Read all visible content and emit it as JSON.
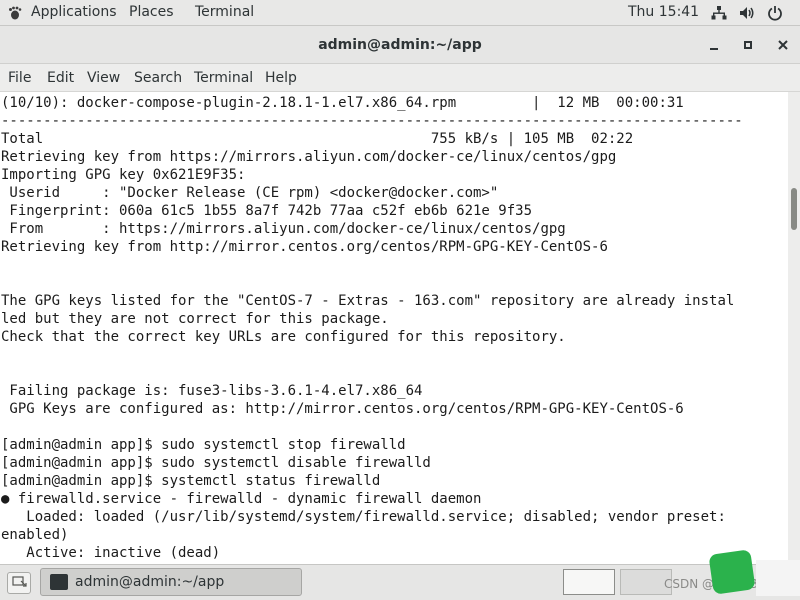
{
  "topbar": {
    "applications": "Applications",
    "places": "Places",
    "terminal": "Terminal",
    "clock": "Thu 15:41",
    "icons": [
      "network-icon",
      "volume-icon",
      "power-icon"
    ]
  },
  "window": {
    "title": "admin@admin:~/app",
    "controls": [
      "minimize-icon",
      "maximize-icon",
      "close-icon"
    ]
  },
  "menu": [
    "File",
    "Edit",
    "View",
    "Search",
    "Terminal",
    "Help"
  ],
  "terminal_lines": [
    "(10/10): docker-compose-plugin-2.18.1-1.el7.x86_64.rpm         |  12 MB  00:00:31",
    "----------------------------------------------------------------------------------------",
    "Total                                              755 kB/s | 105 MB  02:22",
    "Retrieving key from https://mirrors.aliyun.com/docker-ce/linux/centos/gpg",
    "Importing GPG key 0x621E9F35:",
    " Userid     : \"Docker Release (CE rpm) <docker@docker.com>\"",
    " Fingerprint: 060a 61c5 1b55 8a7f 742b 77aa c52f eb6b 621e 9f35",
    " From       : https://mirrors.aliyun.com/docker-ce/linux/centos/gpg",
    "Retrieving key from http://mirror.centos.org/centos/RPM-GPG-KEY-CentOS-6",
    "",
    "",
    "The GPG keys listed for the \"CentOS-7 - Extras - 163.com\" repository are already instal",
    "led but they are not correct for this package.",
    "Check that the correct key URLs are configured for this repository.",
    "",
    "",
    " Failing package is: fuse3-libs-3.6.1-4.el7.x86_64",
    " GPG Keys are configured as: http://mirror.centos.org/centos/RPM-GPG-KEY-CentOS-6",
    "",
    "[admin@admin app]$ sudo systemctl stop firewalld",
    "[admin@admin app]$ sudo systemctl disable firewalld",
    "[admin@admin app]$ systemctl status firewalld",
    "● firewalld.service - firewalld - dynamic firewall daemon",
    "   Loaded: loaded (/usr/lib/systemd/system/firewalld.service; disabled; vendor preset:",
    "enabled)",
    "   Active: inactive (dead)"
  ],
  "taskbar": {
    "task_label": "admin@admin:~/app",
    "watermark": "CSDN @lloyd2365"
  },
  "colors": {
    "background": "#ffffff",
    "text": "#1b1b1b",
    "logo_green": "#2bb24c"
  }
}
